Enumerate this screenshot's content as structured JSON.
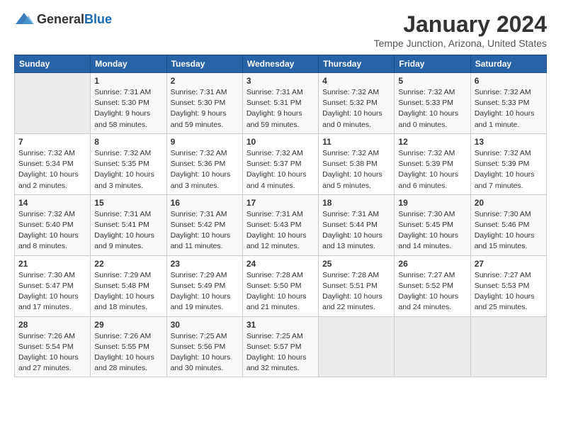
{
  "header": {
    "logo_general": "General",
    "logo_blue": "Blue",
    "title": "January 2024",
    "subtitle": "Tempe Junction, Arizona, United States"
  },
  "days_of_week": [
    "Sunday",
    "Monday",
    "Tuesday",
    "Wednesday",
    "Thursday",
    "Friday",
    "Saturday"
  ],
  "weeks": [
    [
      {
        "day": "",
        "sunrise": "",
        "sunset": "",
        "daylight": ""
      },
      {
        "day": "1",
        "sunrise": "Sunrise: 7:31 AM",
        "sunset": "Sunset: 5:30 PM",
        "daylight": "Daylight: 9 hours and 58 minutes."
      },
      {
        "day": "2",
        "sunrise": "Sunrise: 7:31 AM",
        "sunset": "Sunset: 5:30 PM",
        "daylight": "Daylight: 9 hours and 59 minutes."
      },
      {
        "day": "3",
        "sunrise": "Sunrise: 7:31 AM",
        "sunset": "Sunset: 5:31 PM",
        "daylight": "Daylight: 9 hours and 59 minutes."
      },
      {
        "day": "4",
        "sunrise": "Sunrise: 7:32 AM",
        "sunset": "Sunset: 5:32 PM",
        "daylight": "Daylight: 10 hours and 0 minutes."
      },
      {
        "day": "5",
        "sunrise": "Sunrise: 7:32 AM",
        "sunset": "Sunset: 5:33 PM",
        "daylight": "Daylight: 10 hours and 0 minutes."
      },
      {
        "day": "6",
        "sunrise": "Sunrise: 7:32 AM",
        "sunset": "Sunset: 5:33 PM",
        "daylight": "Daylight: 10 hours and 1 minute."
      }
    ],
    [
      {
        "day": "7",
        "sunrise": "Sunrise: 7:32 AM",
        "sunset": "Sunset: 5:34 PM",
        "daylight": "Daylight: 10 hours and 2 minutes."
      },
      {
        "day": "8",
        "sunrise": "Sunrise: 7:32 AM",
        "sunset": "Sunset: 5:35 PM",
        "daylight": "Daylight: 10 hours and 3 minutes."
      },
      {
        "day": "9",
        "sunrise": "Sunrise: 7:32 AM",
        "sunset": "Sunset: 5:36 PM",
        "daylight": "Daylight: 10 hours and 3 minutes."
      },
      {
        "day": "10",
        "sunrise": "Sunrise: 7:32 AM",
        "sunset": "Sunset: 5:37 PM",
        "daylight": "Daylight: 10 hours and 4 minutes."
      },
      {
        "day": "11",
        "sunrise": "Sunrise: 7:32 AM",
        "sunset": "Sunset: 5:38 PM",
        "daylight": "Daylight: 10 hours and 5 minutes."
      },
      {
        "day": "12",
        "sunrise": "Sunrise: 7:32 AM",
        "sunset": "Sunset: 5:39 PM",
        "daylight": "Daylight: 10 hours and 6 minutes."
      },
      {
        "day": "13",
        "sunrise": "Sunrise: 7:32 AM",
        "sunset": "Sunset: 5:39 PM",
        "daylight": "Daylight: 10 hours and 7 minutes."
      }
    ],
    [
      {
        "day": "14",
        "sunrise": "Sunrise: 7:32 AM",
        "sunset": "Sunset: 5:40 PM",
        "daylight": "Daylight: 10 hours and 8 minutes."
      },
      {
        "day": "15",
        "sunrise": "Sunrise: 7:31 AM",
        "sunset": "Sunset: 5:41 PM",
        "daylight": "Daylight: 10 hours and 9 minutes."
      },
      {
        "day": "16",
        "sunrise": "Sunrise: 7:31 AM",
        "sunset": "Sunset: 5:42 PM",
        "daylight": "Daylight: 10 hours and 11 minutes."
      },
      {
        "day": "17",
        "sunrise": "Sunrise: 7:31 AM",
        "sunset": "Sunset: 5:43 PM",
        "daylight": "Daylight: 10 hours and 12 minutes."
      },
      {
        "day": "18",
        "sunrise": "Sunrise: 7:31 AM",
        "sunset": "Sunset: 5:44 PM",
        "daylight": "Daylight: 10 hours and 13 minutes."
      },
      {
        "day": "19",
        "sunrise": "Sunrise: 7:30 AM",
        "sunset": "Sunset: 5:45 PM",
        "daylight": "Daylight: 10 hours and 14 minutes."
      },
      {
        "day": "20",
        "sunrise": "Sunrise: 7:30 AM",
        "sunset": "Sunset: 5:46 PM",
        "daylight": "Daylight: 10 hours and 15 minutes."
      }
    ],
    [
      {
        "day": "21",
        "sunrise": "Sunrise: 7:30 AM",
        "sunset": "Sunset: 5:47 PM",
        "daylight": "Daylight: 10 hours and 17 minutes."
      },
      {
        "day": "22",
        "sunrise": "Sunrise: 7:29 AM",
        "sunset": "Sunset: 5:48 PM",
        "daylight": "Daylight: 10 hours and 18 minutes."
      },
      {
        "day": "23",
        "sunrise": "Sunrise: 7:29 AM",
        "sunset": "Sunset: 5:49 PM",
        "daylight": "Daylight: 10 hours and 19 minutes."
      },
      {
        "day": "24",
        "sunrise": "Sunrise: 7:28 AM",
        "sunset": "Sunset: 5:50 PM",
        "daylight": "Daylight: 10 hours and 21 minutes."
      },
      {
        "day": "25",
        "sunrise": "Sunrise: 7:28 AM",
        "sunset": "Sunset: 5:51 PM",
        "daylight": "Daylight: 10 hours and 22 minutes."
      },
      {
        "day": "26",
        "sunrise": "Sunrise: 7:27 AM",
        "sunset": "Sunset: 5:52 PM",
        "daylight": "Daylight: 10 hours and 24 minutes."
      },
      {
        "day": "27",
        "sunrise": "Sunrise: 7:27 AM",
        "sunset": "Sunset: 5:53 PM",
        "daylight": "Daylight: 10 hours and 25 minutes."
      }
    ],
    [
      {
        "day": "28",
        "sunrise": "Sunrise: 7:26 AM",
        "sunset": "Sunset: 5:54 PM",
        "daylight": "Daylight: 10 hours and 27 minutes."
      },
      {
        "day": "29",
        "sunrise": "Sunrise: 7:26 AM",
        "sunset": "Sunset: 5:55 PM",
        "daylight": "Daylight: 10 hours and 28 minutes."
      },
      {
        "day": "30",
        "sunrise": "Sunrise: 7:25 AM",
        "sunset": "Sunset: 5:56 PM",
        "daylight": "Daylight: 10 hours and 30 minutes."
      },
      {
        "day": "31",
        "sunrise": "Sunrise: 7:25 AM",
        "sunset": "Sunset: 5:57 PM",
        "daylight": "Daylight: 10 hours and 32 minutes."
      },
      {
        "day": "",
        "sunrise": "",
        "sunset": "",
        "daylight": ""
      },
      {
        "day": "",
        "sunrise": "",
        "sunset": "",
        "daylight": ""
      },
      {
        "day": "",
        "sunrise": "",
        "sunset": "",
        "daylight": ""
      }
    ]
  ]
}
